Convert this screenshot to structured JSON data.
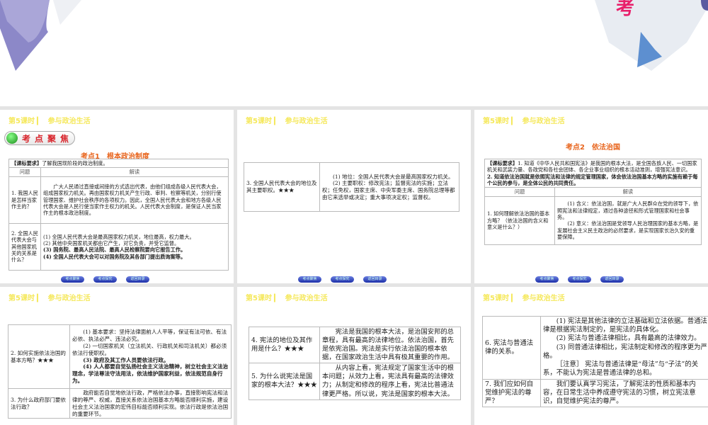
{
  "header": "第5课时",
  "header_sub": "参与政治生活",
  "badge": "考点聚焦",
  "nav": [
    "考点聚焦",
    "考点探究",
    "返回目录"
  ],
  "s1": {
    "title": "考点1　根本政治制度",
    "req_label": "【课标要求】",
    "req": "了解我国现阶段的政治制度。",
    "col1": "问题",
    "col2": "解读",
    "rows": [
      {
        "q": "1. 我国人民是怎样当家作主的？",
        "a": "广大人民通过直接或间接的方式选出代表，由他们组成各级人民代表大会，组成国家权力机关。再由国家权力机关产生行政、审判、检察等机关，分别行使管理国家、维护社会秩序的各项权力。因此，全国人民代表大会和地方各级人民代表大会是人民行使当家作主权力的机关。人民代表大会制度，是保证人民当家作主的根本政治制度。"
      },
      {
        "q": "2. 全国人民代表大会与其他国家机关的关系是什么？",
        "a1": "(1) 全国人民代表大会是最高国家权力机关，地位最高，权力最大。",
        "a2": "(2) 其他中央国家机关都由它产生，对它负责，并受它监督。",
        "a3": "(3) 国务院、最高人民法院、最高人民检察院要向它报告工作。",
        "a4": "(4) 全国人民代表大会可以对国务院及其各部门提出质询案等。"
      }
    ]
  },
  "s2": {
    "q": "3. 全国人民代表大会的地位及其主要职权。★★★",
    "a1": "(1) 地位：全国人民代表大会是最高国家权力机关。",
    "a2": "(2) 主要职权：修改宪法；监督宪法的实施；立法权；任免权，国家主席、中央军委主席、国务院总理等都由它来选举或决定；重大事项决定权；监督权。"
  },
  "s3": {
    "title": "考点2　依法治国",
    "req_label": "【课标要求】",
    "req1": "1. 知道《中华人民共和国宪法》是我国的根本大法，是全国各族人民、一切国家机关和武装力量、各政党和各社会团体、各企业事业组织的根本活动准则，增强宪法意识。",
    "req2": "2. 知道依法治国就是依照宪法和法律的规定管理国家，体会依法治国基本方略的实施有赖于每个公民的参与，是全体公民的共同责任。",
    "col1": "问题",
    "col2": "解读",
    "q": "1. 如何理解依法治国的基本方略？（依法治国的含义和意义是什么？）",
    "a1": "(1) 含义：依法治国，就是广大人民群众在党的领导下，依照宪法和法律规定，通过各种途径和形式管理国家和社会事务。",
    "a2": "(2) 意义：依法治国是党领导人民治理国家的基本方略，是发展社会主义民主政治的必然要求，是实现国家长治久安的重要保障。"
  },
  "s4": {
    "q1": "2. 如何实施依法治国的基本方略？★★★",
    "a1": "(1) 基本要求：坚持法律面前人人平等，保证有法可依、有法必依、执法必严、违法必究。",
    "a2": "(2) 一切国家机关（立法机关、行政机关和司法机关）都必须依法行使职权。",
    "a3": "(3) 政府及其工作人员要依法行政。",
    "a4": "(4) 人人都要自觉弘扬社会主义法治精神，树立社会主义法治理念，学法尊法守法用法，依法维护国家利益，依法规范自身行为。",
    "q2": "3. 为什么政府部门要依法行政？",
    "b": "政府能否自觉地依法行政，严格依法办事，直接影响宪法和法律的尊严、权威，直接关系依法治国基本方略能否顺利实施，建设社会主义法治国家的宏伟目标能否顺利实现。依法行政是依法治国的重要环节。"
  },
  "s5": {
    "q1": "4. 宪法的地位及其作用是什么？★★★",
    "a1": "宪法是我国的根本大法，是治国安邦的总章程，具有最高的法律地位。依法治国，首先是依宪治国。宪法是实行依法治国的根本依据，在国家政治生活中具有极其重要的作用。",
    "q2": "5. 为什么说宪法是国家的根本大法？★★★",
    "a2": "从内容上看，宪法规定了国家生活中的根本问题；从效力上看，宪法具有最高的法律效力；从制定和修改的程序上看，宪法比普通法律更严格。所以说，宪法是国家的根本大法。"
  },
  "s6": {
    "q1": "6. 宪法与普通法律的关系。",
    "a1": "(1) 宪法是其他法律的立法基础和立法依据。普通法律是根据宪法制定的，是宪法的具体化。",
    "a2": "(2) 宪法与普通法律相比，具有最高的法律效力。",
    "a3": "(3) 同普通法律相比，宪法制定和修改的程序更为严格。",
    "a4": "［注意］ 宪法与普通法律是“母法”与“子法”的关系，不能认为宪法是普通法律的总和。",
    "q2": "7. 我们应如何自觉维护宪法的尊严？",
    "a5": "我们要认真学习宪法，了解宪法的性质和基本内容，在日常生活中养成遵守宪法的习惯，树立宪法意识，自觉维护宪法的尊严。"
  }
}
